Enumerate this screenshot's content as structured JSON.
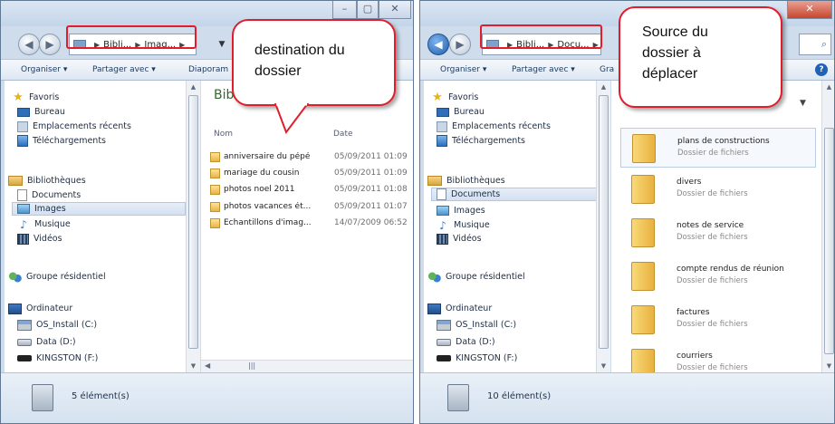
{
  "left_window": {
    "address": [
      "Bibli...",
      "Imag..."
    ],
    "toolbar": {
      "organize": "Organiser ▾",
      "share": "Partager avec ▾",
      "slideshow": "Diaporam"
    },
    "nav": {
      "favorites": "Favoris",
      "desktop": "Bureau",
      "recent": "Emplacements récents",
      "downloads": "Téléchargements",
      "libraries": "Bibliothèques",
      "documents": "Documents",
      "images": "Images",
      "music": "Musique",
      "videos": "Vidéos",
      "homegroup": "Groupe résidentiel",
      "computer": "Ordinateur",
      "os_drive": "OS_Install (C:)",
      "data_drive": "Data (D:)",
      "usb_drive": "KINGSTON (F:)"
    },
    "view_title": "Bibli",
    "columns": {
      "name": "Nom",
      "date": "Date"
    },
    "files": [
      {
        "name": "anniversaire du pépé",
        "date": "05/09/2011 01:09"
      },
      {
        "name": "mariage du cousin",
        "date": "05/09/2011 01:09"
      },
      {
        "name": "photos noel 2011",
        "date": "05/09/2011 01:08"
      },
      {
        "name": "photos vacances ét...",
        "date": "05/09/2011 01:07"
      },
      {
        "name": "Échantillons d'imag...",
        "date": "14/07/2009 06:52"
      }
    ],
    "status": "5 élément(s)"
  },
  "right_window": {
    "address": [
      "Bibli...",
      "Docu..."
    ],
    "toolbar": {
      "organize": "Organiser ▾",
      "share": "Partager avec ▾",
      "burn": "Gra"
    },
    "nav": {
      "favorites": "Favoris",
      "desktop": "Bureau",
      "recent": "Emplacements récents",
      "downloads": "Téléchargements",
      "libraries": "Bibliothèques",
      "documents": "Documents",
      "images": "Images",
      "music": "Musique",
      "videos": "Vidéos",
      "homegroup": "Groupe résidentiel",
      "computer": "Ordinateur",
      "os_drive": "OS_Install (C:)",
      "data_drive": "Data (D:)",
      "usb_drive": "KINGSTON (F:)"
    },
    "folders": [
      {
        "name": "plans de constructions",
        "type": "Dossier de fichiers"
      },
      {
        "name": "divers",
        "type": "Dossier de fichiers"
      },
      {
        "name": "notes de service",
        "type": "Dossier de fichiers"
      },
      {
        "name": "compte rendus de réunion",
        "type": "Dossier de fichiers"
      },
      {
        "name": "factures",
        "type": "Dossier de fichiers"
      },
      {
        "name": "courriers",
        "type": "Dossier de fichiers"
      }
    ],
    "status": "10 élément(s)"
  },
  "callouts": {
    "destination": "destination du dossier",
    "source": "Source du dossier à déplacer"
  },
  "colors": {
    "callout_border": "#e21d2b",
    "accent": "#2e6c2a"
  }
}
